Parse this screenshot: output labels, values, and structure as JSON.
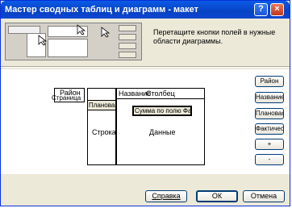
{
  "title": "Мастер сводных таблиц и диаграмм - макет",
  "title_buttons": {
    "help": "?",
    "close": "×"
  },
  "instruction": "Перетащите кнопки полей в нужные области диаграммы.",
  "layout": {
    "page_field": "Район",
    "page_label": "Страница",
    "series_field": "Плановая",
    "row_label": "Строка",
    "row_field_header": "Название",
    "column_field": "Столбец",
    "data_field": "Сумма по полю Фак",
    "data_label": "Данные"
  },
  "fields": [
    "Район",
    "Название",
    "Плановая",
    "Фактичес",
    "+",
    "-"
  ],
  "buttons": {
    "help": "Справка",
    "ok": "ОК",
    "cancel": "Отмена"
  },
  "colors": {
    "titlebar": "#0842c4",
    "dialog": "#ece9d8"
  }
}
